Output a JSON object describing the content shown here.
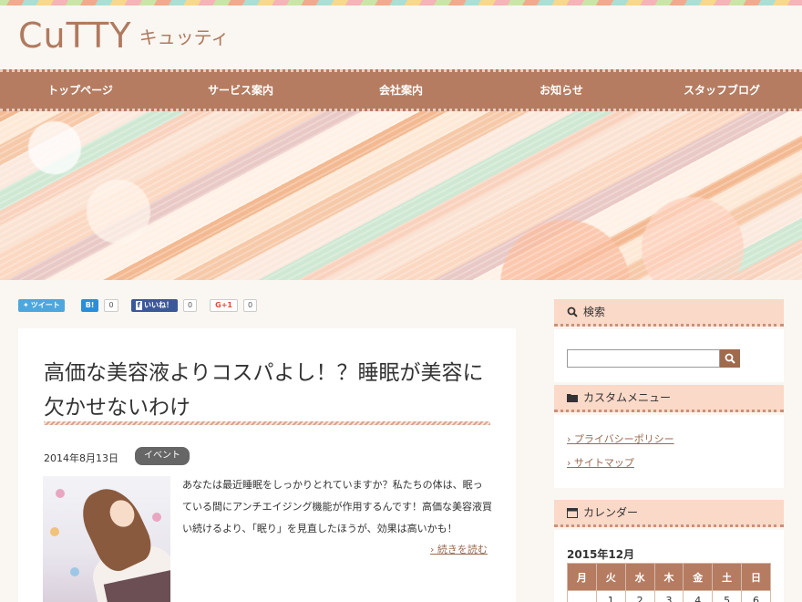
{
  "site": {
    "logo_text": "CuTTY",
    "logo_sub": "キュッティ"
  },
  "nav": {
    "items": [
      "トップページ",
      "サービス案内",
      "会社案内",
      "お知らせ",
      "スタッフブログ"
    ]
  },
  "share": {
    "tweet_label": "ツイート",
    "hatena_label": "B!",
    "hatena_count": "0",
    "like_label": "いいね！",
    "like_count": "0",
    "gplus_label": "G+1",
    "gplus_count": "0"
  },
  "article": {
    "title": "高価な美容液よりコスパよし！？睡眠が美容に欠かせないわけ",
    "date": "2014年8月13日",
    "tag": "イベント",
    "excerpt": "あなたは最近睡眠をしっかりとれていますか？私たちの体は、眠っている間にアンチエイジング機能が作用するんです！高価な美容液買い続けるより、「眠り」を見直したほうが、効果は高いかも！",
    "read_more": "続きを読む"
  },
  "sidebar": {
    "search_title": "検索",
    "search_value": "",
    "menu_title": "カスタムメニュー",
    "menu_items": [
      "プライバシーポリシー",
      "サイトマップ"
    ],
    "calendar_title": "カレンダー",
    "calendar_month": "2015年12月",
    "weekdays": [
      "月",
      "火",
      "水",
      "木",
      "金",
      "土",
      "日"
    ],
    "first_week": [
      "",
      "1",
      "2",
      "3",
      "4",
      "5",
      "6"
    ]
  },
  "colors": {
    "brand": "#b57c61",
    "accent_light": "#fbd9c8",
    "link": "#9a6a50"
  }
}
